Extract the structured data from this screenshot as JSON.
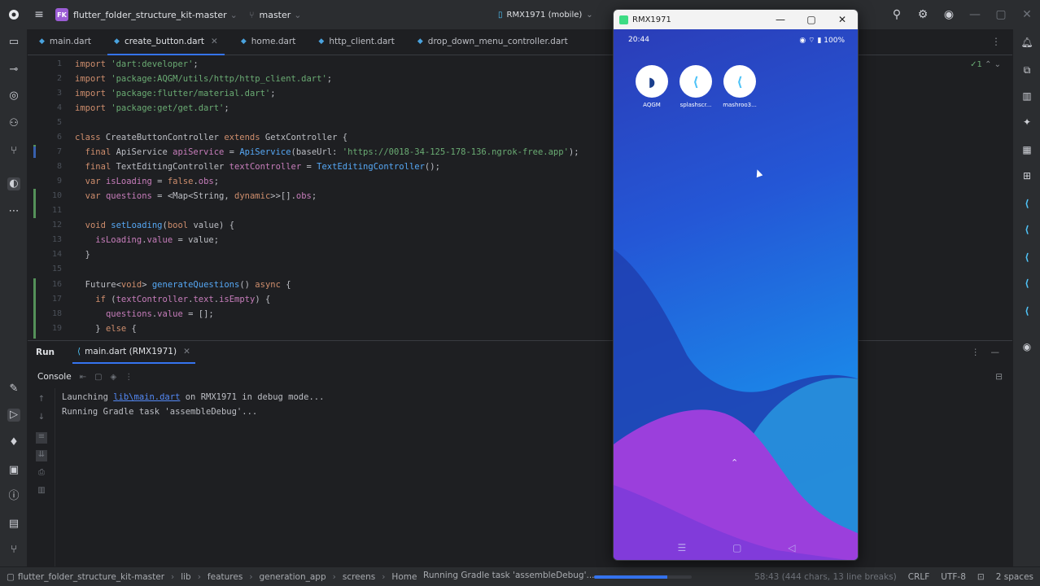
{
  "titlebar": {
    "project_badge": "FK",
    "project_name": "flutter_folder_structure_kit-master",
    "branch": "master",
    "device": "RMX1971 (mobile)"
  },
  "tabs": [
    {
      "label": "main.dart",
      "active": false
    },
    {
      "label": "create_button.dart",
      "active": true
    },
    {
      "label": "home.dart",
      "active": false
    },
    {
      "label": "http_client.dart",
      "active": false
    },
    {
      "label": "drop_down_menu_controller.dart",
      "active": false
    }
  ],
  "editor": {
    "inspection": "✓1",
    "line_numbers": [
      "1",
      "2",
      "3",
      "4",
      "5",
      "6",
      "7",
      "8",
      "9",
      "10",
      "11",
      "12",
      "13",
      "14",
      "15",
      "16",
      "17",
      "18",
      "19"
    ]
  },
  "run": {
    "title": "Run",
    "config_tab": "main.dart (RMX1971)",
    "console_label": "Console",
    "line1_prefix": "Launching ",
    "line1_link": "lib\\main.dart",
    "line1_suffix": " on RMX1971 in debug mode...",
    "line2": "Running Gradle task 'assembleDebug'..."
  },
  "statusbar": {
    "breadcrumbs": [
      "flutter_folder_structure_kit-master",
      "lib",
      "features",
      "generation_app",
      "screens",
      "Home"
    ],
    "task": "Running Gradle task 'assembleDebug'...",
    "progress": 0.75,
    "position": "58:43 (444 chars, 13 line breaks)",
    "line_sep": "CRLF",
    "encoding": "UTF-8",
    "indent": "2 spaces"
  },
  "emulator": {
    "window_title": "RMX1971",
    "time": "20:44",
    "battery": "100%",
    "apps": [
      {
        "label": "AQGM",
        "icon": "aqgm-app-icon"
      },
      {
        "label": "splashscr...",
        "icon": "flutter-app-icon"
      },
      {
        "label": "mashroo3...",
        "icon": "flutter-app-icon"
      }
    ]
  },
  "colors": {
    "accent": "#3574f0",
    "keyword": "#cf8e6d",
    "string": "#6aab73",
    "function": "#56a8f5",
    "field": "#c77dbb"
  }
}
